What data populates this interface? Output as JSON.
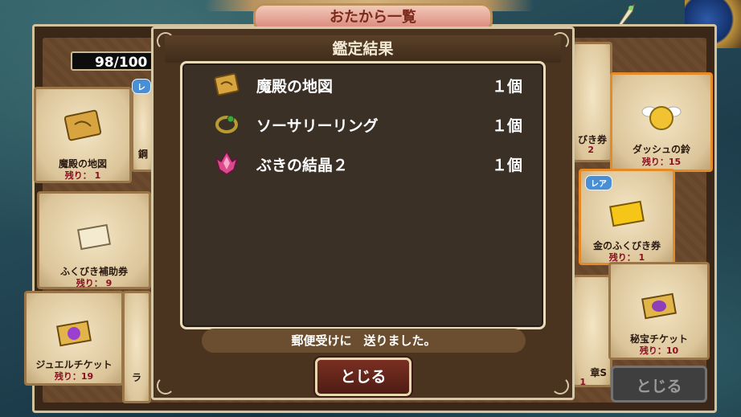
{
  "background_title": "おたから一覧",
  "counter": "98/100",
  "tiles": [
    {
      "name": "魔殿の地図",
      "remain": "残り： 1"
    },
    {
      "name": "ふくびき補助券",
      "remain": "残り： 9"
    },
    {
      "name": "ジュエルチケット",
      "remain": "残り：19"
    },
    {
      "name": "ダッシュの鈴",
      "remain": "残り：15"
    },
    {
      "name": "金のふくびき券",
      "remain": "残り： 1"
    },
    {
      "name": "秘宝チケット",
      "remain": "残り：10"
    }
  ],
  "partial_labels": {
    "left_a": "鋼",
    "left_b": "ラ",
    "right_a": "びき券",
    "right_a_num": "2",
    "right_b": "章S",
    "right_b_num": "1"
  },
  "badges": {
    "rare_left": "レ",
    "rare_right": "レア"
  },
  "back_close_label": "とじる",
  "dialog": {
    "title": "鑑定結果",
    "items": [
      {
        "name": "魔殿の地図",
        "qty": "１個",
        "icon": "treasure-map-icon"
      },
      {
        "name": "ソーサリーリング",
        "qty": "１個",
        "icon": "sorcery-ring-icon"
      },
      {
        "name": "ぶきの結晶２",
        "qty": "１個",
        "icon": "weapon-crystal-icon"
      }
    ],
    "notice": "郵便受けに　送りました。",
    "close_label": "とじる"
  }
}
